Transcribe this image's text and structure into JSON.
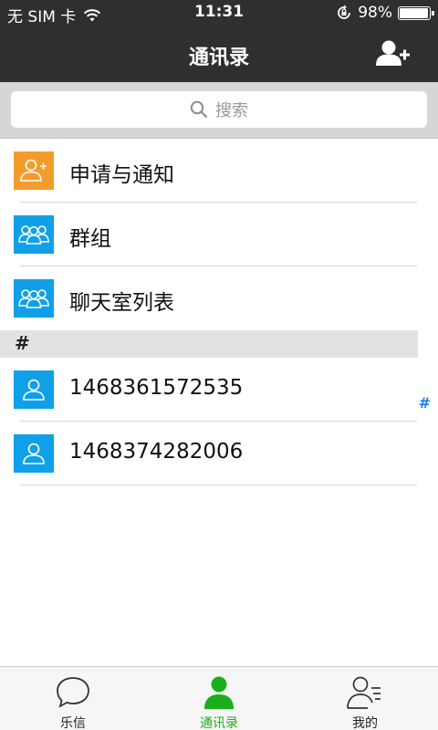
{
  "status_bar": {
    "carrier": "无 SIM 卡",
    "time": "11:31",
    "battery_percent": "98%",
    "battery_level": 0.98
  },
  "nav": {
    "title": "通讯录"
  },
  "search": {
    "placeholder": "搜索"
  },
  "top_items": [
    {
      "label": "申请与通知",
      "icon": "add-person-icon",
      "color": "#f39c2c"
    },
    {
      "label": "群组",
      "icon": "group-icon",
      "color": "#10a0e8"
    },
    {
      "label": "聊天室列表",
      "icon": "group-icon",
      "color": "#10a0e8"
    }
  ],
  "section": {
    "letter": "#"
  },
  "contacts": [
    {
      "name": "1468361572535",
      "icon": "person-icon"
    },
    {
      "name": "1468374282006",
      "icon": "person-icon"
    }
  ],
  "index": {
    "letter": "#"
  },
  "tabs": [
    {
      "label": "乐信",
      "icon": "chat-bubble-icon",
      "active": false
    },
    {
      "label": "通讯录",
      "icon": "contacts-icon",
      "active": true
    },
    {
      "label": "我的",
      "icon": "profile-list-icon",
      "active": false
    }
  ],
  "colors": {
    "active_tab": "#1bb01b",
    "bar_dark": "#2f2f2f",
    "index_blue": "#1a7fe8"
  }
}
